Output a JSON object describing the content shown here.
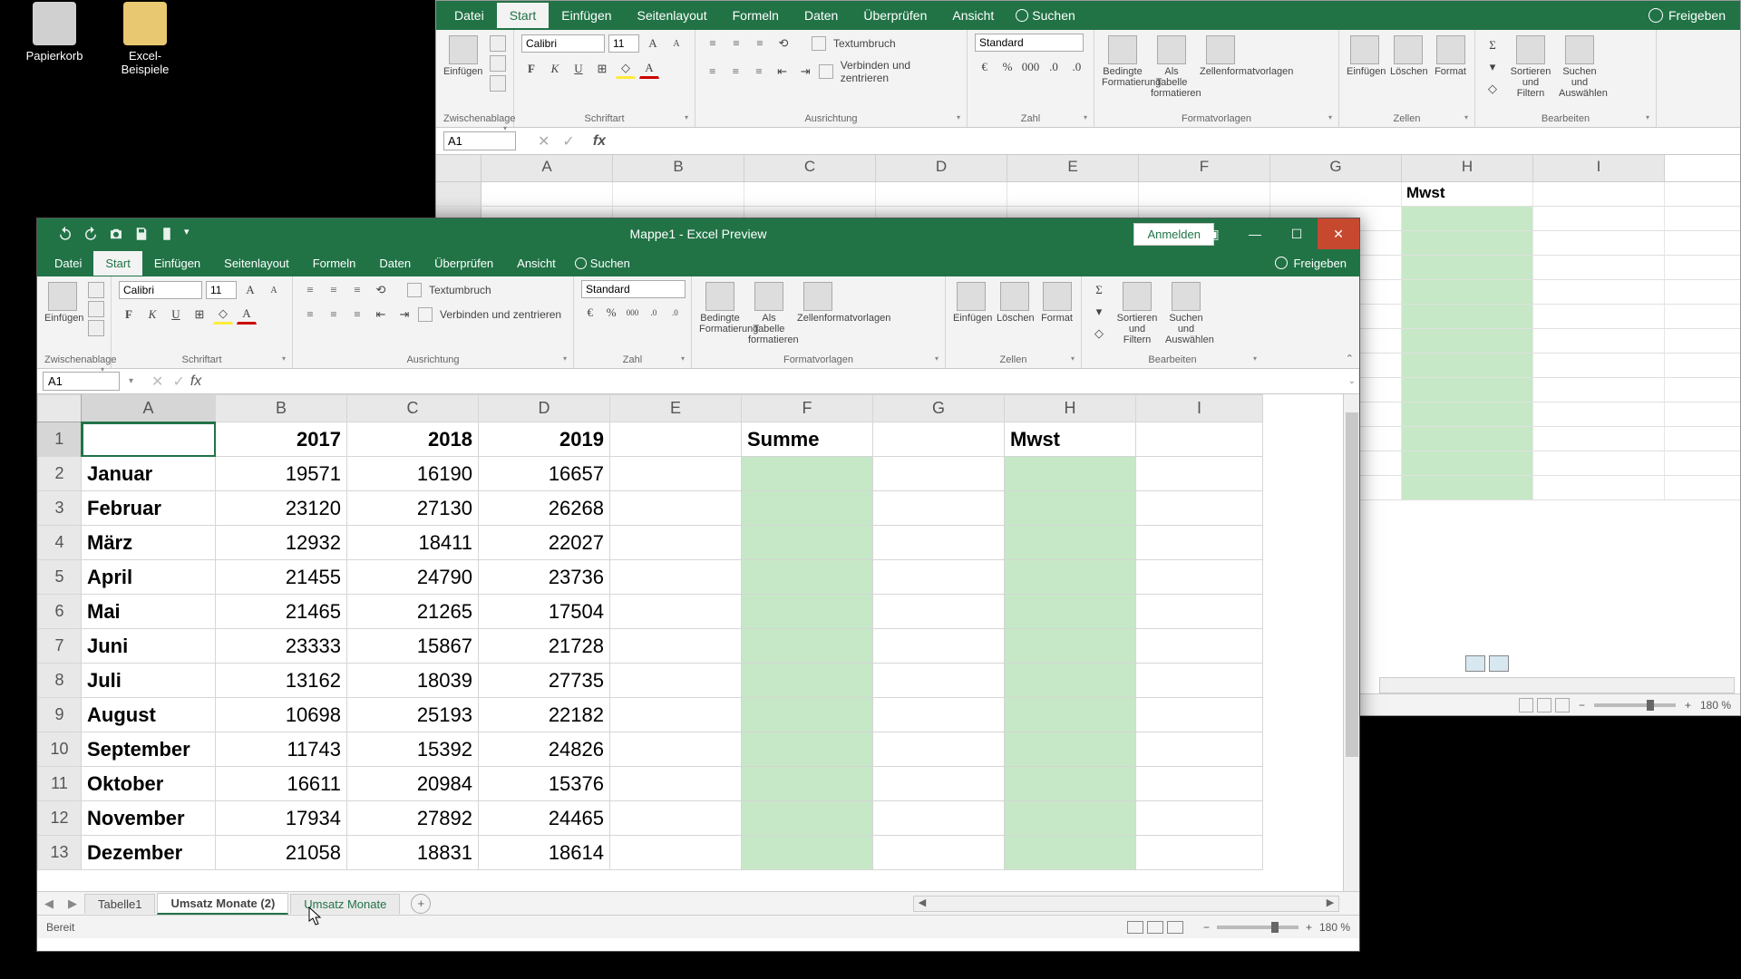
{
  "desktop": {
    "trash": "Papierkorb",
    "folder": "Excel-Beispiele"
  },
  "back_window": {
    "tabs": [
      "Datei",
      "Start",
      "Einfügen",
      "Seitenlayout",
      "Formeln",
      "Daten",
      "Überprüfen",
      "Ansicht"
    ],
    "active_tab": "Start",
    "search": "Suchen",
    "freigeben": "Freigeben",
    "ribbon": {
      "clipboard_title": "Zwischenablage",
      "paste": "Einfügen",
      "font_title": "Schriftart",
      "font_name": "Calibri",
      "font_size": "11",
      "bold": "F",
      "italic": "K",
      "underline": "U",
      "align_title": "Ausrichtung",
      "wrap": "Textumbruch",
      "merge": "Verbinden und zentrieren",
      "number_title": "Zahl",
      "number_format": "Standard",
      "styles_title": "Formatvorlagen",
      "cond_fmt": "Bedingte Formatierung",
      "as_table": "Als Tabelle formatieren",
      "cell_styles": "Zellenformatvorlagen",
      "cells_title": "Zellen",
      "insert": "Einfügen",
      "delete": "Löschen",
      "format": "Format",
      "editing_title": "Bearbeiten",
      "sort": "Sortieren und Filtern",
      "find": "Suchen und Auswählen"
    },
    "namebox": "A1",
    "columns": [
      "A",
      "B",
      "C",
      "D",
      "E",
      "F",
      "G",
      "H",
      "I"
    ],
    "mwst": "Mwst",
    "zoom": "180 %"
  },
  "front_window": {
    "title": "Mappe1 - Excel Preview",
    "anmelden": "Anmelden",
    "tabs": [
      "Datei",
      "Start",
      "Einfügen",
      "Seitenlayout",
      "Formeln",
      "Daten",
      "Überprüfen",
      "Ansicht"
    ],
    "active_tab": "Start",
    "search": "Suchen",
    "freigeben": "Freigeben",
    "ribbon": {
      "clipboard_title": "Zwischenablage",
      "paste": "Einfügen",
      "font_title": "Schriftart",
      "font_name": "Calibri",
      "font_size": "11",
      "bold": "F",
      "italic": "K",
      "underline": "U",
      "align_title": "Ausrichtung",
      "wrap": "Textumbruch",
      "merge": "Verbinden und zentrieren",
      "number_title": "Zahl",
      "number_format": "Standard",
      "styles_title": "Formatvorlagen",
      "cond_fmt": "Bedingte Formatierung",
      "as_table": "Als Tabelle formatieren",
      "cell_styles": "Zellenformatvorlagen",
      "cells_title": "Zellen",
      "insert": "Einfügen",
      "delete": "Löschen",
      "format": "Format",
      "editing_title": "Bearbeiten",
      "sort": "Sortieren und Filtern",
      "find": "Suchen und Auswählen"
    },
    "namebox": "A1",
    "columns": [
      "A",
      "B",
      "C",
      "D",
      "E",
      "F",
      "G",
      "H",
      "I"
    ],
    "headers": {
      "y2017": "2017",
      "y2018": "2018",
      "y2019": "2019",
      "summe": "Summe",
      "mwst": "Mwst"
    },
    "rows": [
      {
        "m": "Januar",
        "a": "19571",
        "b": "16190",
        "c": "16657"
      },
      {
        "m": "Februar",
        "a": "23120",
        "b": "27130",
        "c": "26268"
      },
      {
        "m": "März",
        "a": "12932",
        "b": "18411",
        "c": "22027"
      },
      {
        "m": "April",
        "a": "21455",
        "b": "24790",
        "c": "23736"
      },
      {
        "m": "Mai",
        "a": "21465",
        "b": "21265",
        "c": "17504"
      },
      {
        "m": "Juni",
        "a": "23333",
        "b": "15867",
        "c": "21728"
      },
      {
        "m": "Juli",
        "a": "13162",
        "b": "18039",
        "c": "27735"
      },
      {
        "m": "August",
        "a": "10698",
        "b": "25193",
        "c": "22182"
      },
      {
        "m": "September",
        "a": "11743",
        "b": "15392",
        "c": "24826"
      },
      {
        "m": "Oktober",
        "a": "16611",
        "b": "20984",
        "c": "15376"
      },
      {
        "m": "November",
        "a": "17934",
        "b": "27892",
        "c": "24465"
      },
      {
        "m": "Dezember",
        "a": "21058",
        "b": "18831",
        "c": "18614"
      }
    ],
    "sheet_tabs": [
      "Tabelle1",
      "Umsatz Monate (2)",
      "Umsatz Monate"
    ],
    "active_sheet": 1,
    "status": "Bereit",
    "zoom": "180 %"
  }
}
